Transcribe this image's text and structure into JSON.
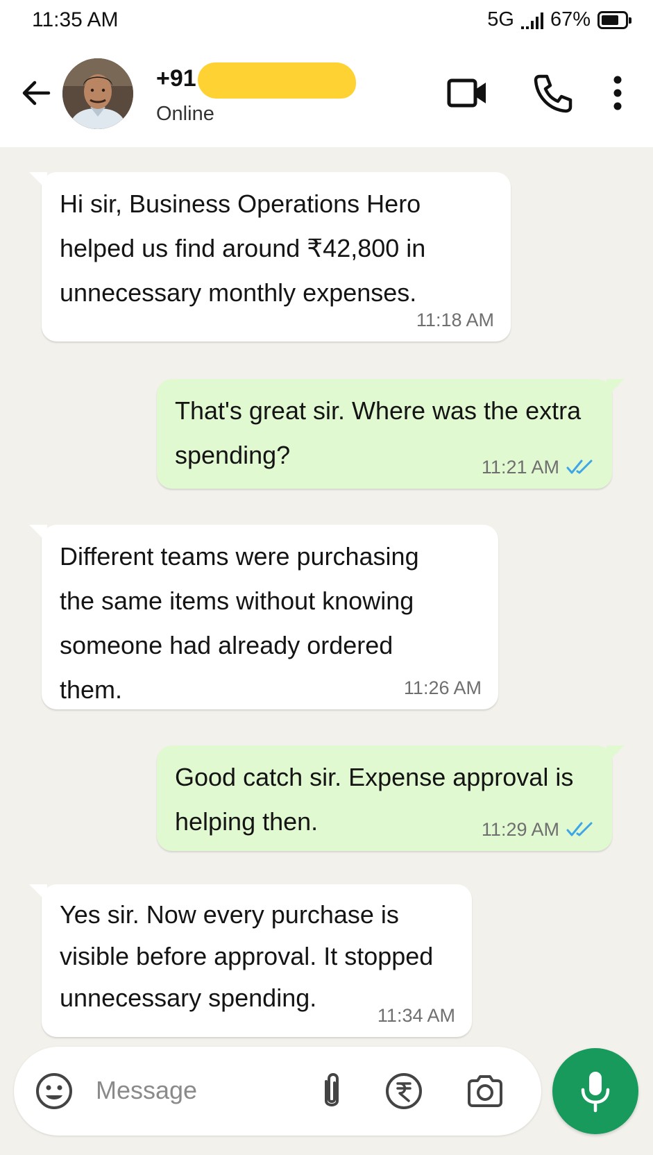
{
  "status_bar": {
    "time": "11:35 AM",
    "network": "5G",
    "battery": "67%",
    "icons": [
      "signal-icon",
      "battery-icon"
    ]
  },
  "header": {
    "contact_name": "+91",
    "status": "Online",
    "icons": [
      "back-arrow-icon",
      "video-call-icon",
      "phone-icon",
      "more-vertical-icon"
    ]
  },
  "messages": [
    {
      "direction": "incoming",
      "text": "Hi sir, Business Operations Hero helped us find around ₹42,800 in unnecessary monthly expenses.",
      "time": "11:18 AM"
    },
    {
      "direction": "outgoing",
      "text": "That's great sir. Where was the extra spending?",
      "time": "11:21 AM",
      "read": true
    },
    {
      "direction": "incoming",
      "text": "Different teams were purchasing the same items without knowing someone had already ordered them.",
      "time": "11:26 AM"
    },
    {
      "direction": "outgoing",
      "text": "Good catch sir. Expense approval is helping then.",
      "time": "11:29 AM",
      "read": true
    },
    {
      "direction": "incoming",
      "text": "Yes sir. Now every purchase is visible before approval. It stopped unnecessary spending.",
      "time": "11:34 AM"
    }
  ],
  "composer": {
    "placeholder": "Message",
    "icons": [
      "emoji-icon",
      "attach-icon",
      "rupee-icon",
      "camera-icon",
      "mic-icon"
    ]
  },
  "colors": {
    "outgoing_bubble": "#e1f9d1",
    "incoming_bubble": "#ffffff",
    "chat_background": "#f3f1ec",
    "accent_green": "#179a5c",
    "read_tick": "#3ea6e6"
  }
}
